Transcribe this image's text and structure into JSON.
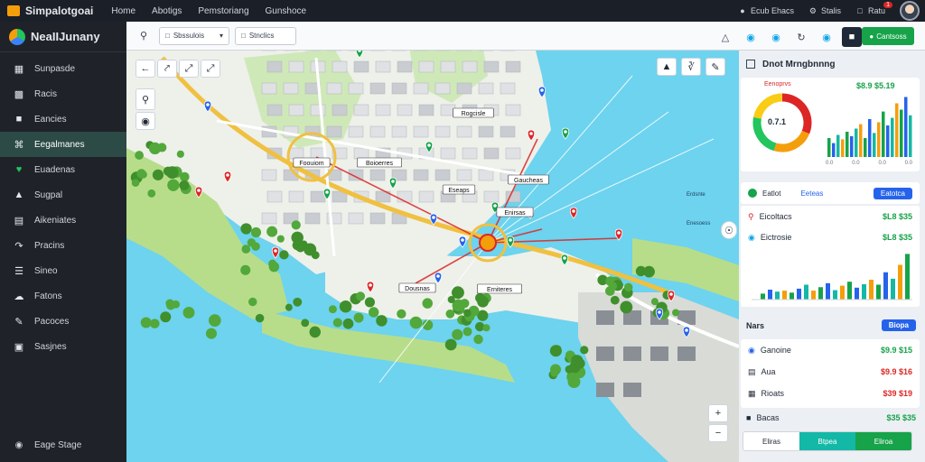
{
  "topbar": {
    "app_name": "Simpalotgoai",
    "nav": [
      "Home",
      "Abotigs",
      "Pemstoriang",
      "Gunshoce"
    ],
    "right": [
      {
        "icon": "user-icon",
        "label": "Ecub Ehacs"
      },
      {
        "icon": "gear-icon",
        "label": "Stalis"
      },
      {
        "icon": "bell-icon",
        "label": "Ratu"
      }
    ],
    "notif_count": "1"
  },
  "sidebar": {
    "brand": "NeaIIJunany",
    "items": [
      {
        "icon": "grid-icon",
        "label": "Sunpasde"
      },
      {
        "icon": "chart-icon",
        "label": "Racis"
      },
      {
        "icon": "folder-icon",
        "label": "Eancies"
      },
      {
        "icon": "map-icon",
        "label": "Eegalmanes",
        "active": true
      },
      {
        "icon": "heart-icon",
        "label": "Euadenas",
        "sub": true
      },
      {
        "icon": "layers-icon",
        "label": "Sugpal"
      },
      {
        "icon": "table-icon",
        "label": "Aikeniates"
      },
      {
        "icon": "route-icon",
        "label": "Pracins"
      },
      {
        "icon": "list-icon",
        "label": "Sineo"
      },
      {
        "icon": "cloud-icon",
        "label": "Fatons"
      },
      {
        "icon": "pen-icon",
        "label": "Pacoces"
      },
      {
        "icon": "image-icon",
        "label": "Sasjnes"
      }
    ],
    "footer": "Eage Stage"
  },
  "toolbar": {
    "dropdown1": "Sbssulois",
    "dropdown2": "Stnclics",
    "primary_button": "Cantsoss"
  },
  "map": {
    "labels": [
      "Foouiom",
      "Boioerres",
      "Rogcisle",
      "Eseaps",
      "Gaucheas",
      "Enirsas",
      "Dousnas",
      "Erniteres"
    ],
    "water_labels": [
      "Erdsnte",
      "Enesoess"
    ]
  },
  "panel": {
    "title": "Dnot Mrngbnnng",
    "summary": {
      "gauge_label": "Eenoprvs",
      "gauge_value": "0.7.1",
      "chart_value": "$8.9 $5.19",
      "gauge_fraction": 0.78,
      "x_ticks": [
        "0.0",
        "0.0",
        "0.0",
        "0.0"
      ],
      "bars": [
        0.3,
        0.22,
        0.35,
        0.28,
        0.4,
        0.33,
        0.45,
        0.52,
        0.3,
        0.6,
        0.38,
        0.55,
        0.72,
        0.5,
        0.62,
        0.85,
        0.75,
        0.95,
        0.66
      ]
    },
    "tabs": {
      "tab1": "Eatlot",
      "tab2": "Eeteas",
      "tab3": "Eatotca"
    },
    "metrics": [
      {
        "label": "Eicoltacs",
        "value": "$L8 $35"
      },
      {
        "label": "Eictrosie",
        "value": "$L8 $35"
      }
    ],
    "metrics_bars": [
      0.12,
      0.2,
      0.16,
      0.18,
      0.14,
      0.22,
      0.3,
      0.18,
      0.25,
      0.33,
      0.19,
      0.28,
      0.36,
      0.24,
      0.31,
      0.4,
      0.3,
      0.55,
      0.42,
      0.7,
      0.92
    ],
    "list_header": "Nars",
    "list_button": "Biopa",
    "list": [
      {
        "label": "Ganoine",
        "value": "$9.9 $15",
        "tone": "pos"
      },
      {
        "label": "Aua",
        "value": "$9.9 $16",
        "tone": "neg"
      },
      {
        "label": "Rioats",
        "value": "$39 $19",
        "tone": "neg"
      }
    ],
    "footer_label": "Bacas",
    "footer_value": "$35 $35",
    "footer_buttons": {
      "left": "Eliras",
      "middle": "Btpea",
      "right": "Eliroa"
    }
  }
}
